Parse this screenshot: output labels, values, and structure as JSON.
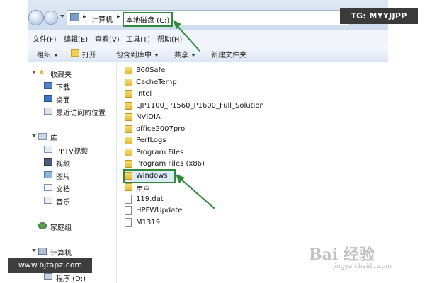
{
  "address_bar": {
    "segments": [
      "计算机",
      "本地磁盘 (C:)"
    ],
    "separator": "▸"
  },
  "menu": {
    "items": [
      "文件(F)",
      "编辑(E)",
      "查看(V)",
      "工具(T)",
      "帮助(H)"
    ]
  },
  "toolbar": {
    "organize": "组织",
    "open": "打开",
    "include_in_library": "包含到库中",
    "share": "共享",
    "new_folder": "新建文件夹"
  },
  "nav_pane": {
    "favorites": {
      "label": "收藏夹",
      "items": [
        "下载",
        "桌面",
        "最近访问的位置"
      ]
    },
    "libraries": {
      "label": "库",
      "items": [
        "PPTV视频",
        "视频",
        "图片",
        "文档",
        "音乐"
      ]
    },
    "homegroup": "家庭组",
    "computer": {
      "label": "计算机",
      "items": [
        "程序 (D:)"
      ]
    }
  },
  "files": [
    {
      "name": "360Safe",
      "type": "folder"
    },
    {
      "name": "CacheTemp",
      "type": "folder"
    },
    {
      "name": "Intel",
      "type": "folder"
    },
    {
      "name": "LJP1100_P1560_P1600_Full_Solution",
      "type": "folder"
    },
    {
      "name": "NVIDIA",
      "type": "folder"
    },
    {
      "name": "office2007pro",
      "type": "folder"
    },
    {
      "name": "PerfLogs",
      "type": "folder"
    },
    {
      "name": "Program Files",
      "type": "folder"
    },
    {
      "name": "Program Files (x86)",
      "type": "folder"
    },
    {
      "name": "Windows",
      "type": "folder",
      "selected": true
    },
    {
      "name": "用户",
      "type": "folder"
    },
    {
      "name": "119.dat",
      "type": "file"
    },
    {
      "name": "HPFWUpdate",
      "type": "file"
    },
    {
      "name": "M1319",
      "type": "file"
    }
  ],
  "overlays": {
    "tg_badge": "TG: MYYJJPP",
    "site_badge": "www.bjtapz.com",
    "watermark": "Bai 经验",
    "watermark_sub": "jingyan.baidu.com"
  },
  "colors": {
    "highlight": "#2f8a3a",
    "selection": "#dcebfc"
  }
}
